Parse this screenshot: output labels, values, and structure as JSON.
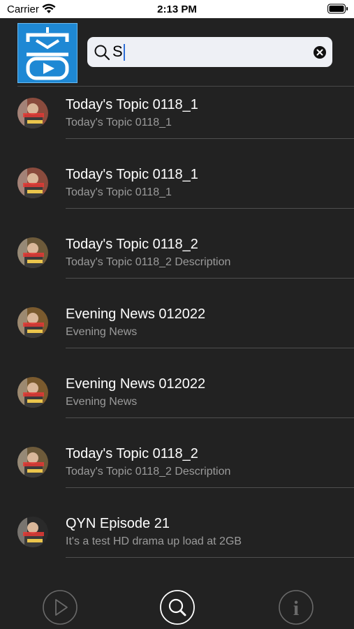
{
  "status_bar": {
    "carrier": "Carrier",
    "time": "2:13 PM"
  },
  "header": {
    "logo_icon": "app-logo-play-icon",
    "search": {
      "value": "S",
      "search_icon": "magnifier-icon",
      "clear_icon": "clear-x-icon"
    }
  },
  "results": [
    {
      "title": "Today's Topic 0118_1",
      "subtitle": "Today's Topic 0118_1",
      "thumb_color": "#8a4b3d"
    },
    {
      "title": "Today's Topic 0118_1",
      "subtitle": "Today's Topic 0118_1",
      "thumb_color": "#8a4b3d"
    },
    {
      "title": "Today's Topic 0118_2",
      "subtitle": "Today's Topic 0118_2 Description",
      "thumb_color": "#6d5a3a"
    },
    {
      "title": "Evening News 012022",
      "subtitle": "Evening News",
      "thumb_color": "#7a5a2e"
    },
    {
      "title": "Evening News 012022",
      "subtitle": "Evening News",
      "thumb_color": "#7a5a2e"
    },
    {
      "title": "Today's Topic 0118_2",
      "subtitle": "Today's Topic 0118_2 Description",
      "thumb_color": "#6d5a3a"
    },
    {
      "title": "QYN Episode 21",
      "subtitle": "It's a test HD drama up load at 2GB",
      "thumb_color": "#2a2a2a"
    }
  ],
  "tab_bar": {
    "tabs": [
      {
        "icon": "play-icon",
        "selected": false
      },
      {
        "icon": "search-icon",
        "selected": true
      },
      {
        "icon": "info-icon",
        "selected": false
      }
    ],
    "info_glyph": "i"
  }
}
